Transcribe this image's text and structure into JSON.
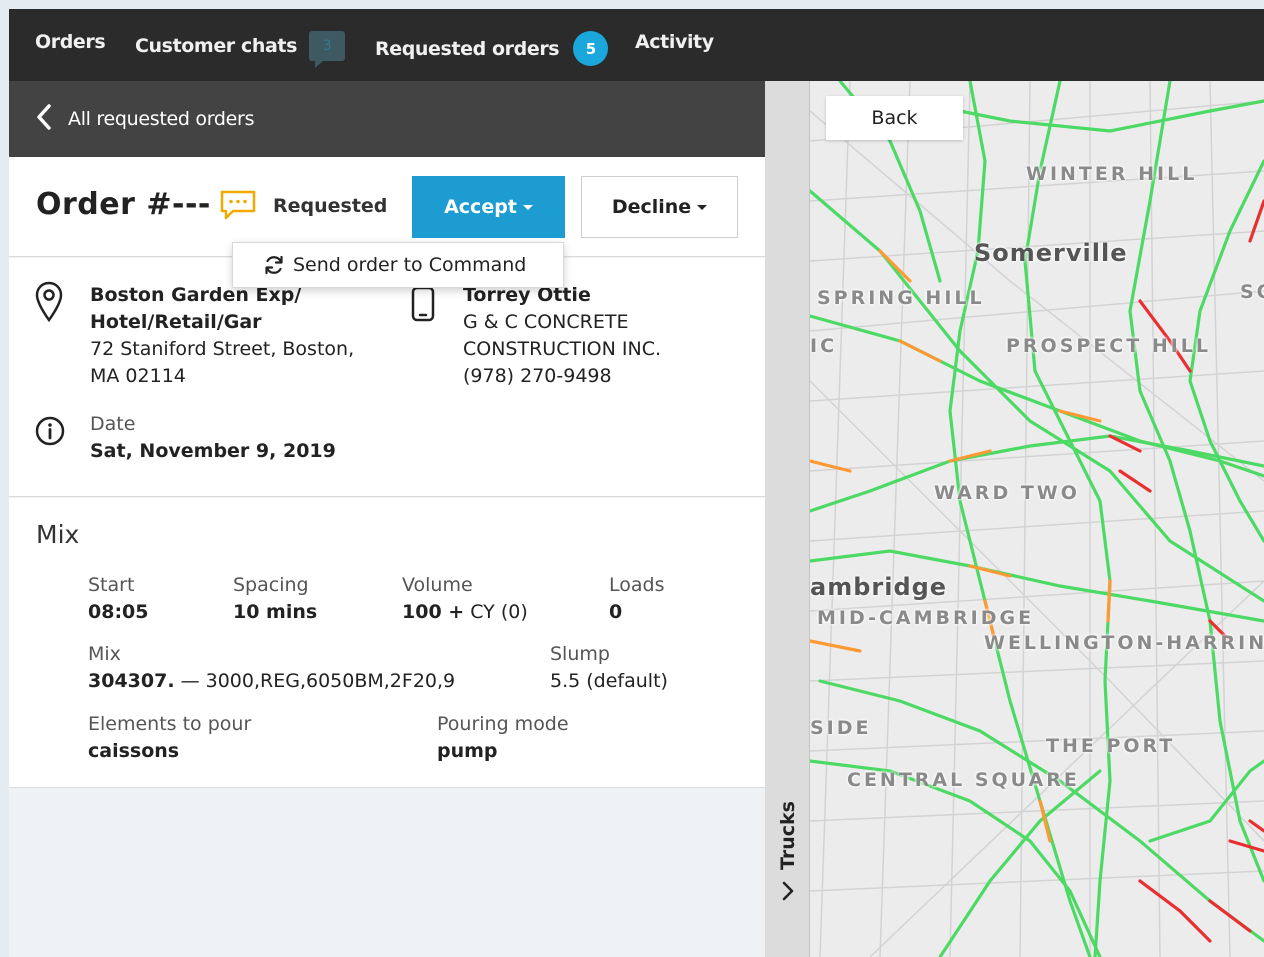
{
  "nav": {
    "orders": "Orders",
    "customer_chats": "Customer chats",
    "chat_count": "3",
    "requested_orders": "Requested orders",
    "requested_count": "5",
    "activity": "Activity"
  },
  "back_bar": {
    "label": "All requested orders"
  },
  "order": {
    "title": "Order #---",
    "status": "Requested",
    "accept_label": "Accept",
    "decline_label": "Decline",
    "dropdown_item": "Send order to Command"
  },
  "location": {
    "name_line1": "Boston Garden Exp/",
    "name_line2": "Hotel/Retail/Gar",
    "street": "72 Staniford Street, Boston,",
    "city": "MA 02114"
  },
  "contact": {
    "name": "Torrey Ottie",
    "company_line1": "G & C CONCRETE",
    "company_line2": "CONSTRUCTION INC.",
    "phone": "(978) 270-9498"
  },
  "date": {
    "label": "Date",
    "value": "Sat, November 9, 2019"
  },
  "mix": {
    "title": "Mix",
    "start_label": "Start",
    "start_value": "08:05",
    "spacing_label": "Spacing",
    "spacing_value": "10 mins",
    "volume_label": "Volume",
    "volume_value": "100 +",
    "volume_unit": " CY (0)",
    "loads_label": "Loads",
    "loads_value": "0",
    "mix_label": "Mix",
    "mix_code": "304307.",
    "mix_desc": " — 3000,REG,6050BM,2F20,9",
    "slump_label": "Slump",
    "slump_value": "5.5 (default)",
    "elements_label": "Elements to pour",
    "elements_value": "caissons",
    "pouring_label": "Pouring mode",
    "pouring_value": "pump"
  },
  "trucks": {
    "label": "Trucks"
  },
  "map": {
    "back_label": "Back",
    "labels": {
      "winter_hill": "WINTER HILL",
      "somerville": "Somerville",
      "spring_hill": "SPRING HILL",
      "prospect_hill": "PROSPECT HILL",
      "ward_two": "WARD TWO",
      "cambridge": "ambridge",
      "mid_cambridge": "MID-CAMBRIDGE",
      "wellington": "WELLINGTON-HARRIN",
      "the_port": "THE PORT",
      "central_square": "CENTRAL SQUARE",
      "side": "SIDE",
      "ic": "IC",
      "so": "SO"
    }
  },
  "colors": {
    "nav_bg": "#2b2b2b",
    "back_bar_bg": "#434343",
    "accent": "#1c9cd0",
    "badge": "#1aa7db",
    "status_icon": "#f2a900",
    "traffic_green": "#4cd964",
    "traffic_orange": "#ff9933",
    "traffic_red": "#e83030"
  }
}
